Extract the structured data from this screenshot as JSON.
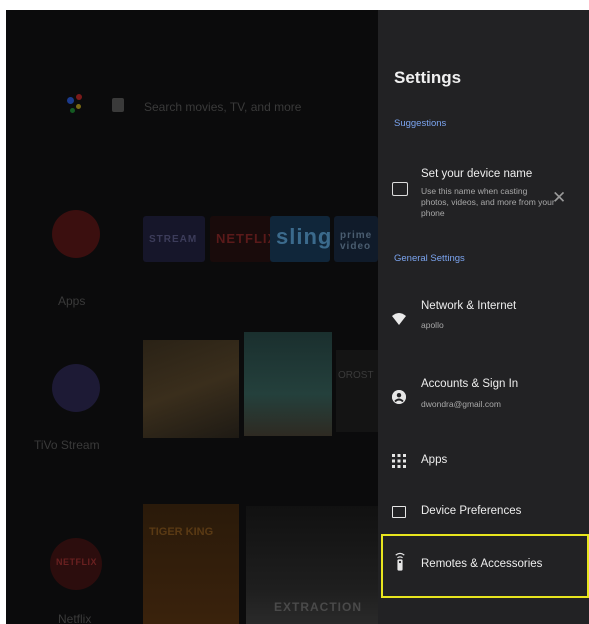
{
  "home": {
    "search_placeholder": "Search movies, TV, and more",
    "apps_label": "Apps",
    "tivo_label": "TiVo Stream",
    "netflix_label": "Netflix",
    "netflix_tile_text": "NETFLIX",
    "tiles": [
      "STREAM",
      "NETFLIX",
      "sling",
      "prime video"
    ],
    "poster_c_text": "OROST",
    "poster_d_text": "TIGER KING",
    "poster_e_text": "EXTRACTION"
  },
  "settings": {
    "title": "Settings",
    "suggestions_header": "Suggestions",
    "device_name": {
      "title": "Set your device name",
      "subtitle": "Use this name when casting photos, videos, and more from your phone",
      "dismiss": "✕"
    },
    "general_header": "General Settings",
    "network": {
      "title": "Network & Internet",
      "subtitle": "apollo"
    },
    "accounts": {
      "title": "Accounts & Sign In",
      "subtitle": "dwondra@gmail.com"
    },
    "apps": {
      "title": "Apps"
    },
    "device_prefs": {
      "title": "Device Preferences"
    },
    "remotes": {
      "title": "Remotes & Accessories"
    }
  },
  "colors": {
    "panel_bg": "#222224",
    "section_header": "#7ba4ef",
    "highlight": "#e8e51e"
  },
  "icons": [
    "google-assistant-icon",
    "input-icon",
    "cast-icon",
    "close-icon",
    "wifi-icon",
    "account-icon",
    "apps-grid-icon",
    "monitor-icon",
    "remote-icon"
  ]
}
